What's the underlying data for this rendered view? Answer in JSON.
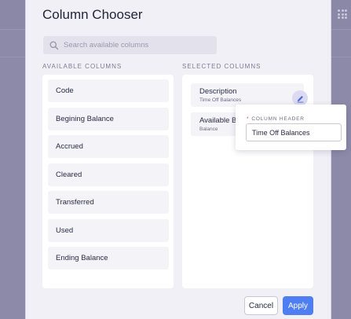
{
  "modal": {
    "title": "Column Chooser"
  },
  "search": {
    "placeholder": "Search available columns"
  },
  "available": {
    "heading": "AVAILABLE COLUMNS",
    "items": [
      "Code",
      "Begining Balance",
      "Accrued",
      "Cleared",
      "Transferred",
      "Used",
      "Ending Balance"
    ]
  },
  "selected": {
    "heading": "SELECTED COLUMNS",
    "items": [
      {
        "label": "Description",
        "sublabel": "Time Off Balances"
      },
      {
        "label": "Available Bal",
        "sublabel": "Balance"
      }
    ]
  },
  "popover": {
    "required_mark": "*",
    "label": "COLUMN HEADER",
    "value": "Time Off Balances"
  },
  "footer": {
    "cancel": "Cancel",
    "apply": "Apply"
  },
  "colors": {
    "accent": "#4f7ef2",
    "required": "#d9434a"
  },
  "icons": {
    "search": "search-icon",
    "edit": "pencil-icon",
    "apps": "grid-icon"
  }
}
